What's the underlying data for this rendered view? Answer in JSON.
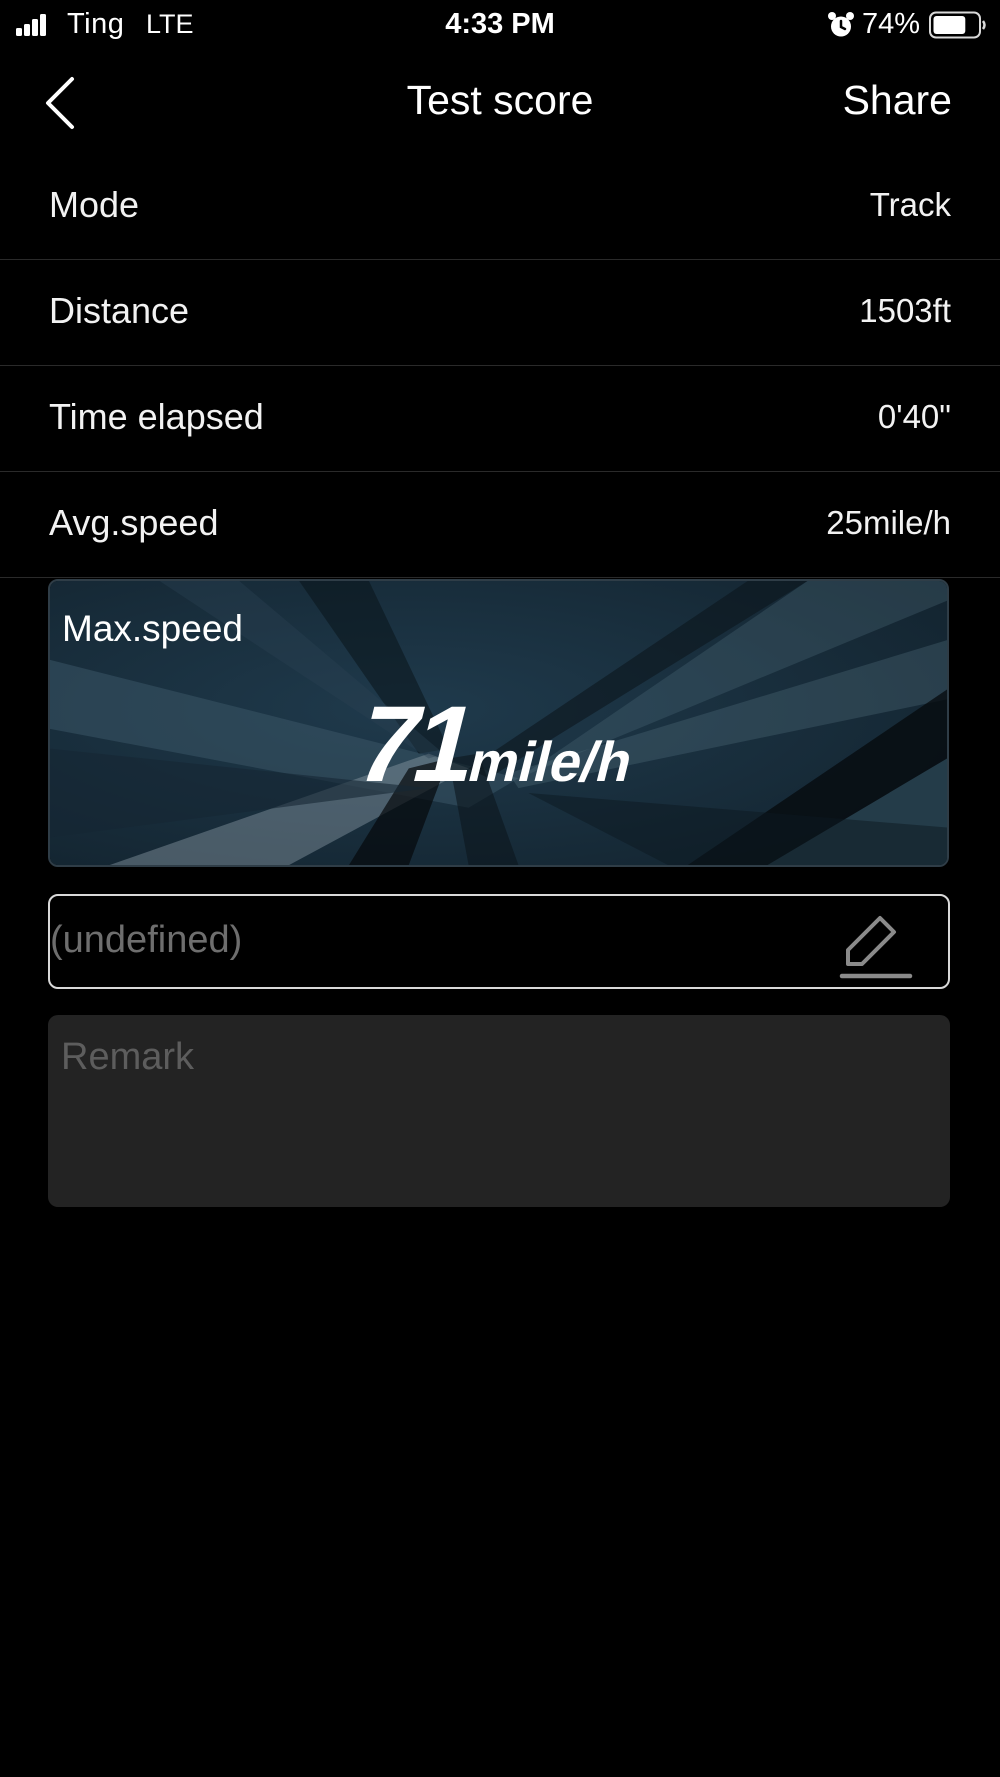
{
  "status_bar": {
    "carrier": "Ting",
    "network": "LTE",
    "time": "4:33 PM",
    "battery_percent": "74%",
    "signal_bars": 4,
    "battery_level": 0.74
  },
  "nav": {
    "back_icon": "chevron-left-icon",
    "title": "Test score",
    "share_label": "Share"
  },
  "stats": [
    {
      "label": "Mode",
      "value": "Track"
    },
    {
      "label": "Distance",
      "value": "1503ft"
    },
    {
      "label": "Time elapsed",
      "value": "0'40\""
    },
    {
      "label": "Avg.speed",
      "value": "25mile/h"
    }
  ],
  "max_speed": {
    "label": "Max.speed",
    "value": "71",
    "unit": "mile/h"
  },
  "name_field": {
    "value": "(undefined)",
    "edit_icon": "pencil-edit-icon"
  },
  "remark": {
    "placeholder": "Remark"
  },
  "colors": {
    "background": "#000000",
    "card_background": "#1c3342",
    "remark_background": "#232323",
    "muted_text": "#6e6e6e"
  }
}
